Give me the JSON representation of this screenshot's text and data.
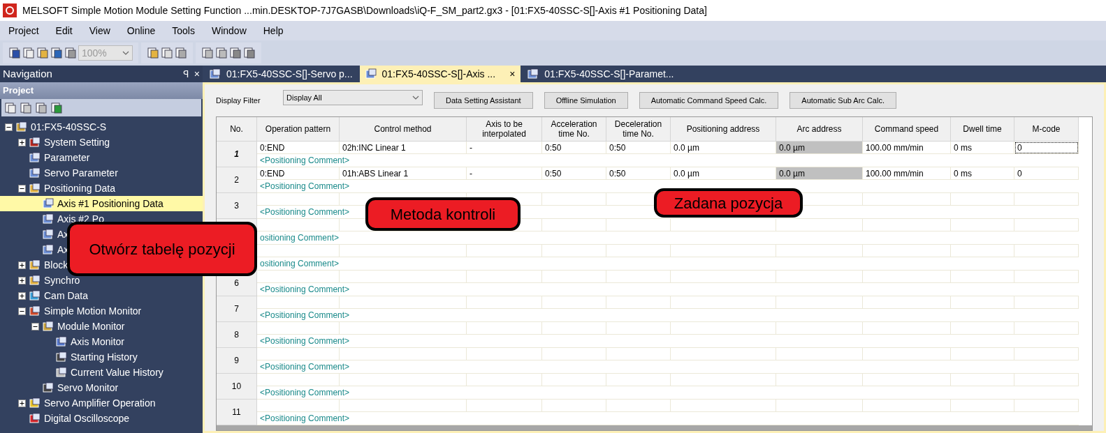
{
  "window": {
    "title": "MELSOFT Simple Motion Module Setting Function ...min.DESKTOP-7J7GASB\\Downloads\\iQ-F_SM_part2.gx3 - [01:FX5-40SSC-S[]-Axis #1 Positioning Data]"
  },
  "menu": [
    "Project",
    "Edit",
    "View",
    "Online",
    "Tools",
    "Window",
    "Help"
  ],
  "toolbar": {
    "zoom": "100%"
  },
  "navigation": {
    "title": "Navigation",
    "pin": "ꟼ",
    "close": "×",
    "section": "Project",
    "tree": [
      {
        "label": "01:FX5-40SSC-S",
        "kind": "module",
        "expanded": true,
        "selected": false,
        "children": [
          {
            "label": "System Setting",
            "kind": "system",
            "expanded": false,
            "selected": false
          },
          {
            "label": "Parameter",
            "kind": "data",
            "selected": false
          },
          {
            "label": "Servo Parameter",
            "kind": "data",
            "selected": false
          },
          {
            "label": "Positioning Data",
            "kind": "folder",
            "expanded": true,
            "selected": false,
            "children": [
              {
                "label": "Axis #1 Positioning Data",
                "kind": "data",
                "selected": true
              },
              {
                "label": "Axis #2 Po",
                "kind": "data",
                "selected": false
              },
              {
                "label": "Ax",
                "kind": "data",
                "selected": false
              },
              {
                "label": "Ax",
                "kind": "data",
                "selected": false
              }
            ]
          },
          {
            "label": "Block",
            "kind": "folder",
            "expanded": false,
            "selected": false
          },
          {
            "label": "Synchro",
            "kind": "folder",
            "expanded": false,
            "selected": false
          },
          {
            "label": "Cam Data",
            "kind": "cam",
            "expanded": false,
            "selected": false
          },
          {
            "label": "Simple Motion Monitor",
            "kind": "monitor",
            "expanded": true,
            "selected": false,
            "children": [
              {
                "label": "Module Monitor",
                "kind": "search",
                "expanded": true,
                "selected": false,
                "children": [
                  {
                    "label": "Axis Monitor",
                    "kind": "window",
                    "selected": false
                  },
                  {
                    "label": "Starting History",
                    "kind": "list",
                    "selected": false
                  },
                  {
                    "label": "Current Value History",
                    "kind": "cursor",
                    "selected": false
                  }
                ]
              },
              {
                "label": "Servo Monitor",
                "kind": "list",
                "selected": false
              }
            ]
          },
          {
            "label": "Servo Amplifier Operation",
            "kind": "amp",
            "expanded": false,
            "selected": false
          },
          {
            "label": "Digital Oscilloscope",
            "kind": "scope",
            "selected": false
          }
        ]
      }
    ]
  },
  "tabs": [
    {
      "label": "01:FX5-40SSC-S[]-Servo p...",
      "selected": false
    },
    {
      "label": "01:FX5-40SSC-S[]-Axis ...",
      "selected": true,
      "close": "×"
    },
    {
      "label": "01:FX5-40SSC-S[]-Paramet...",
      "selected": false
    }
  ],
  "filter": {
    "label": "Display Filter",
    "value": "Display All"
  },
  "buttons": [
    "Data Setting Assistant",
    "Offline Simulation",
    "Automatic Command Speed Calc.",
    "Automatic Sub Arc Calc."
  ],
  "table": {
    "columns": [
      {
        "label": "No."
      },
      {
        "label": "Operation pattern"
      },
      {
        "label": "Control method"
      },
      {
        "label": "Axis to be interpolated"
      },
      {
        "label": "Acceleration time No."
      },
      {
        "label": "Deceleration time No."
      },
      {
        "label": "Positioning address"
      },
      {
        "label": "Arc address",
        "shaded": true
      },
      {
        "label": "Command speed"
      },
      {
        "label": "Dwell time"
      },
      {
        "label": "M-code"
      }
    ],
    "rows": [
      {
        "no": "1",
        "selected": true,
        "cells": [
          "0:END",
          "02h:INC Linear 1",
          "-",
          "0:50",
          "0:50",
          "0.0 µm",
          "0.0 µm",
          "100.00 mm/min",
          "0 ms",
          "0"
        ],
        "comment": "<Positioning Comment>"
      },
      {
        "no": "2",
        "selected": false,
        "cells": [
          "0:END",
          "01h:ABS Linear 1",
          "-",
          "0:50",
          "0:50",
          "0.0 µm",
          "0.0 µm",
          "100.00 mm/min",
          "0 ms",
          "0"
        ],
        "comment": "<Positioning Comment>"
      },
      {
        "no": "3",
        "selected": false,
        "comment": "<Positioning Comment>"
      },
      {
        "comment": "ositioning Comment>"
      },
      {
        "comment": "ositioning Comment>"
      },
      {
        "no": "6",
        "selected": false,
        "comment": "<Positioning Comment>"
      },
      {
        "no": "7",
        "selected": false,
        "comment": "<Positioning Comment>"
      },
      {
        "no": "8",
        "selected": false,
        "comment": "<Positioning Comment>"
      },
      {
        "no": "9",
        "selected": false,
        "comment": "<Positioning Comment>"
      },
      {
        "no": "10",
        "selected": false,
        "comment": "<Positioning Comment>"
      },
      {
        "no": "11",
        "selected": false,
        "comment": "<Positioning Comment>"
      }
    ]
  },
  "callouts": [
    {
      "text": "Otwórz tabelę pozycji"
    },
    {
      "text": "Metoda kontroli"
    },
    {
      "text": "Zadana pozycja"
    }
  ]
}
